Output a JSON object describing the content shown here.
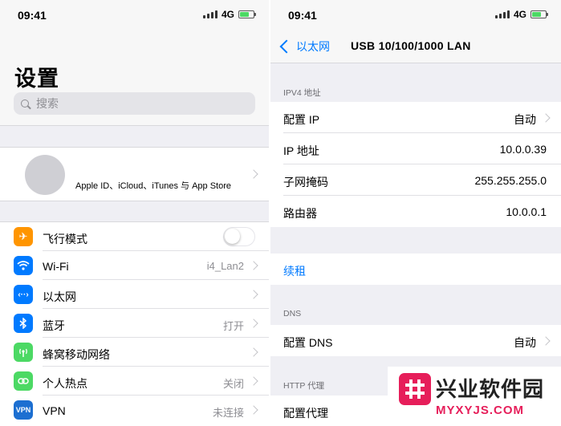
{
  "left": {
    "status": {
      "time": "09:41",
      "network": "4G"
    },
    "title": "设置",
    "search": {
      "placeholder": "搜索"
    },
    "profile": {
      "subtitle": "Apple ID、iCloud、iTunes 与 App Store"
    },
    "rows": [
      {
        "label": "飞行模式",
        "value": "",
        "icon": "airplane-icon",
        "color": "#ff9500",
        "toggle": false
      },
      {
        "label": "Wi-Fi",
        "value": "i4_Lan2",
        "icon": "wifi-icon",
        "color": "#007aff"
      },
      {
        "label": "以太网",
        "value": "",
        "icon": "ethernet-icon",
        "color": "#007aff"
      },
      {
        "label": "蓝牙",
        "value": "打开",
        "icon": "bluetooth-icon",
        "color": "#007aff"
      },
      {
        "label": "蜂窝移动网络",
        "value": "",
        "icon": "cellular-icon",
        "color": "#4cd964"
      },
      {
        "label": "个人热点",
        "value": "关闭",
        "icon": "hotspot-icon",
        "color": "#4cd964"
      },
      {
        "label": "VPN",
        "value": "未连接",
        "icon": "vpn-icon",
        "color": "#1c6fd1",
        "icon_text": "VPN"
      }
    ]
  },
  "right": {
    "status": {
      "time": "09:41",
      "network": "4G"
    },
    "nav": {
      "back_label": "以太网",
      "title": "USB 10/100/1000 LAN"
    },
    "ipv4_header": "IPV4 地址",
    "ipv4_rows": [
      {
        "label": "配置 IP",
        "value": "自动"
      },
      {
        "label": "IP 地址",
        "value": "10.0.0.39"
      },
      {
        "label": "子网掩码",
        "value": "255.255.255.0"
      },
      {
        "label": "路由器",
        "value": "10.0.0.1"
      }
    ],
    "renew_label": "续租",
    "dns_header": "DNS",
    "dns_row": {
      "label": "配置 DNS",
      "value": "自动"
    },
    "proxy_header": "HTTP 代理",
    "proxy_row": {
      "label": "配置代理"
    }
  },
  "watermark": {
    "title": "兴业软件园",
    "url": "MYXYJS.COM"
  }
}
